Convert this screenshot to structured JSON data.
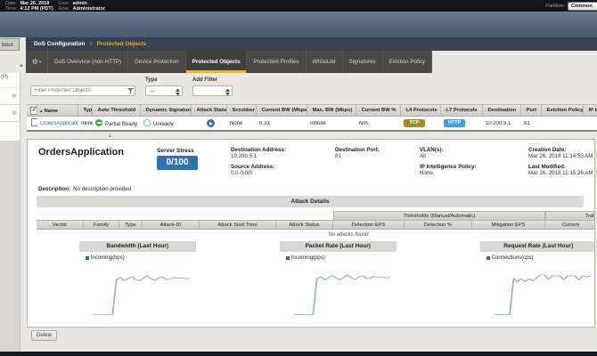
{
  "topbar": {
    "date_label": "Date:",
    "date": "Mar 26, 2018",
    "time_label": "Time:",
    "time": "4:12 PM (PDT)",
    "user_label": "User:",
    "user": "admin",
    "role_label": "Role:",
    "role": "Administrator",
    "partition_label": "Partition:",
    "partition": "Common"
  },
  "sidebar": {
    "cut_tab_text": "bout",
    "cut_item_text": "(P)",
    "collapse_glyph": "◄",
    "plus_glyph": "⊕"
  },
  "breadcrumb": {
    "section": "DoS Configuration",
    "separator": "»",
    "page": "Protected Objects"
  },
  "tabbar": {
    "gear_glyph": "⚙",
    "tabs": [
      {
        "label": "DoS Overview (non-HTTP)",
        "active": false
      },
      {
        "label": "Device Protection",
        "active": false
      },
      {
        "label": "Protected Objects",
        "active": true
      },
      {
        "label": "Protection Profiles",
        "active": false
      },
      {
        "label": "WhiteList",
        "active": false
      },
      {
        "label": "Signatures",
        "active": false
      },
      {
        "label": "Eviction Policy",
        "active": false
      }
    ]
  },
  "filter": {
    "search_placeholder": "Filter Protected Objects",
    "type_label": "Type",
    "type_value": "—",
    "add_filter_label": "Add Filter",
    "add_filter_value": ""
  },
  "objects_table": {
    "columns": [
      "",
      "Name",
      "Type",
      "Auto Threshold",
      "Dynamic Signatures",
      "Attack Status",
      "Scrubber",
      "Current BW (Mbps)",
      "Max. BW (Mbps)",
      "Current BW %",
      "L4 Protocols",
      "L7 Protocols",
      "Destination",
      "Port",
      "Eviction Policy",
      "IP Intelligence"
    ],
    "row": [
      {
        "type": "checkbox",
        "checked": false
      },
      {
        "type": "link",
        "text": "OrdersApplication"
      },
      {
        "type": "text",
        "text": "Inline"
      },
      {
        "type": "icon-text",
        "icon": "partial-ready-icon",
        "text": "Partial Ready"
      },
      {
        "type": "icon-text",
        "icon": "unready-icon",
        "text": "Unready"
      },
      {
        "type": "icon",
        "icon": "attack-status-ok-icon"
      },
      {
        "type": "text",
        "text": "None"
      },
      {
        "type": "text",
        "text": "0.23"
      },
      {
        "type": "text",
        "text": "Infinite"
      },
      {
        "type": "text",
        "text": "N/A"
      },
      {
        "type": "badge",
        "text": "TCP",
        "color": "#a28d1c"
      },
      {
        "type": "badge",
        "text": "HTTP",
        "color": "#3da0e2"
      },
      {
        "type": "text",
        "text": "10.200.5.1"
      },
      {
        "type": "text",
        "text": "81"
      },
      {
        "type": "text",
        "text": ""
      },
      {
        "type": "text",
        "text": ""
      }
    ]
  },
  "details": {
    "title": "OrdersApplication",
    "server_stress_label": "Server Stress",
    "server_stress_value": "0/100",
    "server_stress_color": "#2e74b5",
    "field_columns": [
      [
        {
          "label": "Destination Address:",
          "value": "10.200.5.1"
        },
        {
          "label": "Source Address:",
          "value": "0.0.0.0/0"
        }
      ],
      [
        {
          "label": "Destination Port:",
          "value": "81"
        }
      ],
      [
        {
          "label": "VLAN(s):",
          "value": "All"
        },
        {
          "label": "IP Intelligence Policy:",
          "value": "None"
        }
      ],
      [
        {
          "label": "Creation Date:",
          "value": "Mar 26, 2018 11:14:53 AM"
        },
        {
          "label": "Last Modified:",
          "value": "Mar 26, 2018 11:15:28 AM"
        }
      ]
    ],
    "description_label": "Description:",
    "description_value": "No description provided",
    "attack_details_title": "Attack Details"
  },
  "attack_table": {
    "group_headers": [
      {
        "label": "",
        "span": 6,
        "filled": false
      },
      {
        "label": "Thresholds (Manual/Automatic)",
        "span": 3,
        "filled": true
      },
      {
        "label": "Traffic EPS",
        "span": 2,
        "filled": true
      }
    ],
    "columns": [
      "Vector",
      "Family",
      "Type",
      "Attack-ID",
      "Attack Start Time",
      "Attack Status",
      "Detection EPS",
      "Detection %",
      "Mitigation EPS",
      "Current",
      ""
    ],
    "empty_text": "No attacks found"
  },
  "chart_data": [
    {
      "type": "line",
      "title": "Bandwidth (Last Hour)",
      "legend": [
        {
          "name": "Incoming(bps)",
          "marker_color": "#1f6bb0",
          "line_color": "#8ab6d6"
        }
      ],
      "x_axis": {
        "label": "",
        "range": "last hour",
        "ticks_visible": false
      },
      "y_axis": {
        "label": "",
        "ticks_visible": false
      },
      "series": [
        {
          "name": "Incoming(bps)",
          "values_relative": [
            5,
            5,
            5,
            5,
            5,
            5,
            74,
            79,
            73,
            76,
            80,
            75,
            72,
            77,
            82,
            76,
            73,
            78,
            80,
            74,
            76,
            79,
            77,
            78,
            76,
            77
          ],
          "shape": "flat near zero, sharp step up ~1/3 in, noisy plateau"
        }
      ]
    },
    {
      "type": "line",
      "title": "Packet Rate (Last Hour)",
      "legend": [
        {
          "name": "Incoming(pps)",
          "marker_color": "#1f6bb0",
          "line_color": "#8ab6d6"
        }
      ],
      "x_axis": {
        "label": "",
        "range": "last hour",
        "ticks_visible": false
      },
      "y_axis": {
        "label": "",
        "ticks_visible": false
      },
      "series": [
        {
          "name": "Incoming(pps)",
          "values_relative": [
            5,
            5,
            5,
            5,
            5,
            5,
            76,
            80,
            74,
            78,
            83,
            77,
            74,
            79,
            84,
            78,
            75,
            80,
            82,
            76,
            78,
            81,
            79,
            80,
            78,
            79
          ],
          "shape": "flat near zero, sharp step up ~1/3 in, noisy plateau"
        }
      ]
    },
    {
      "type": "line",
      "title": "Request Rate (Last Hour)",
      "legend": [
        {
          "name": "Connections(cps)",
          "marker_color": "#1f6bb0",
          "line_color": "#8ab6d6"
        }
      ],
      "x_axis": {
        "label": "",
        "range": "last hour",
        "ticks_visible": false
      },
      "y_axis": {
        "label": "",
        "ticks_visible": false
      },
      "series": [
        {
          "name": "Connections(cps)",
          "values_relative": [
            5,
            5,
            5,
            5,
            5,
            76,
            70,
            76,
            70,
            76,
            72,
            78,
            84,
            84,
            75,
            82,
            82,
            82,
            74,
            82,
            82,
            82,
            74,
            82,
            80,
            81
          ],
          "shape": "flat near zero, sharp step up ~1/3 in, square-wave plateau"
        }
      ]
    }
  ],
  "actions": {
    "delete_label": "Delete"
  },
  "colors": {
    "active_tab_underline": "#f7b50a",
    "breadcrumb_highlight": "#f2a71d",
    "link": "#2f6eb5",
    "status_green": "#3cab45",
    "attack_status_blue": "#2e74b5",
    "tcp_badge": "#a28d1c",
    "http_badge": "#3da0e2"
  }
}
